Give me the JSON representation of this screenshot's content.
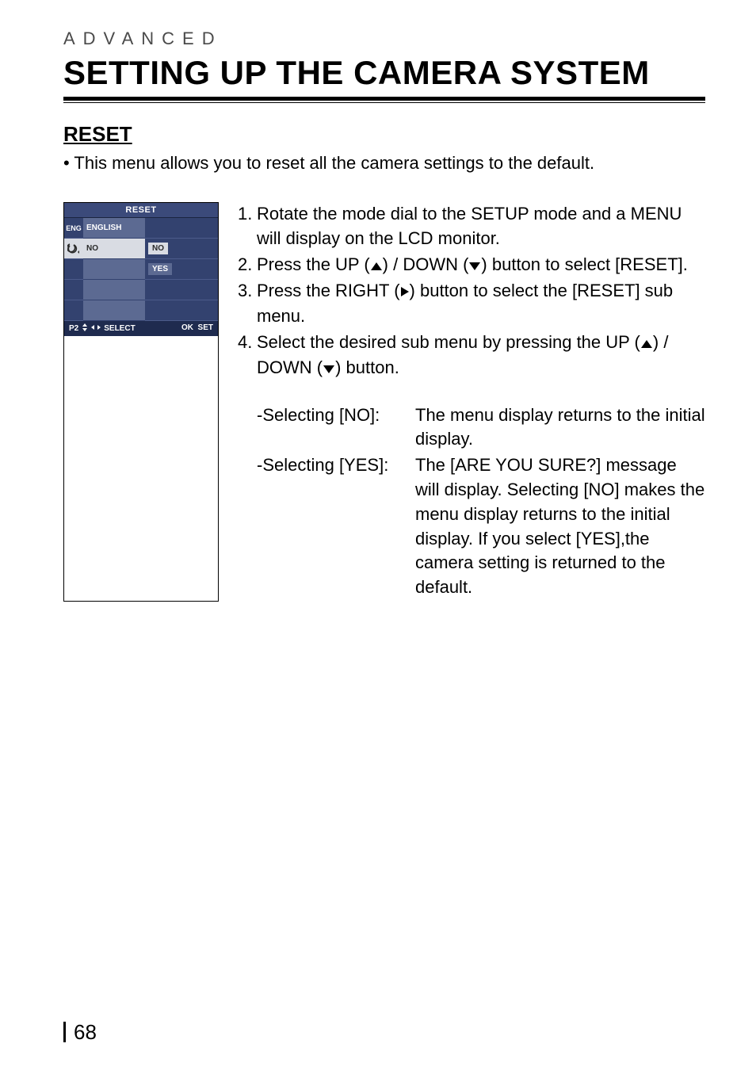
{
  "header": {
    "section_label": "ADVANCED",
    "title": "SETTING UP THE CAMERA SYSTEM"
  },
  "subheading": "RESET",
  "intro": "• This menu allows you to reset all the camera settings to the default.",
  "lcd": {
    "title": "RESET",
    "icon_eng": "ENG",
    "row_english": "ENGLISH",
    "row_no_left": "NO",
    "opt_no": "NO",
    "opt_yes": "YES",
    "footer_p2": "P2",
    "footer_select": "SELECT",
    "footer_ok": "OK",
    "footer_set": "SET"
  },
  "steps": [
    {
      "num": "1.",
      "text": "Rotate the mode dial to the SETUP mode and a MENU will display on the LCD monitor."
    },
    {
      "num": "2.",
      "text_pre": "Press the UP (",
      "text_mid": ") / DOWN (",
      "text_post": ") button to select [RESET]."
    },
    {
      "num": "3.",
      "text_pre": "Press the RIGHT  (",
      "text_post": ") button to select the [RESET] sub menu."
    },
    {
      "num": "4.",
      "text_pre": "Select the desired sub menu by pressing the UP (",
      "text_mid": ") / DOWN (",
      "text_post": ") button."
    }
  ],
  "selections": [
    {
      "label": "-Selecting [NO]:",
      "desc": "The menu display returns to the initial display."
    },
    {
      "label": "-Selecting [YES]:",
      "desc": "The [ARE YOU SURE?] message will display. Selecting [NO] makes the menu display returns to the initial display. If you select [YES],the camera setting is returned to the default."
    }
  ],
  "page_number": "68"
}
